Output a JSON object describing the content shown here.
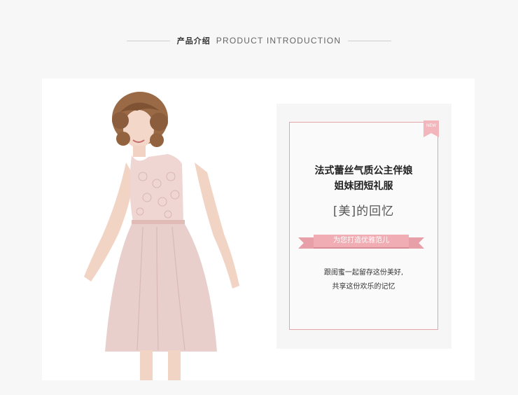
{
  "header": {
    "title_cn": "产品介绍",
    "title_en": "PRODUCT INTRODUCTION"
  },
  "product": {
    "badge": "NEW",
    "title_line1": "法式蕾丝气质公主伴娘",
    "title_line2": "姐妹团短礼服",
    "beauty_text": "[美]的回忆",
    "ribbon_text": "为您打造优雅范儿",
    "desc_line1": "跟闺蜜一起留存这份美好,",
    "desc_line2": "共享这份欢乐的记忆"
  },
  "colors": {
    "accent_pink": "#f0adb4",
    "frame_pink": "#e7a4ab",
    "dress_pink": "#e8cfcc"
  }
}
